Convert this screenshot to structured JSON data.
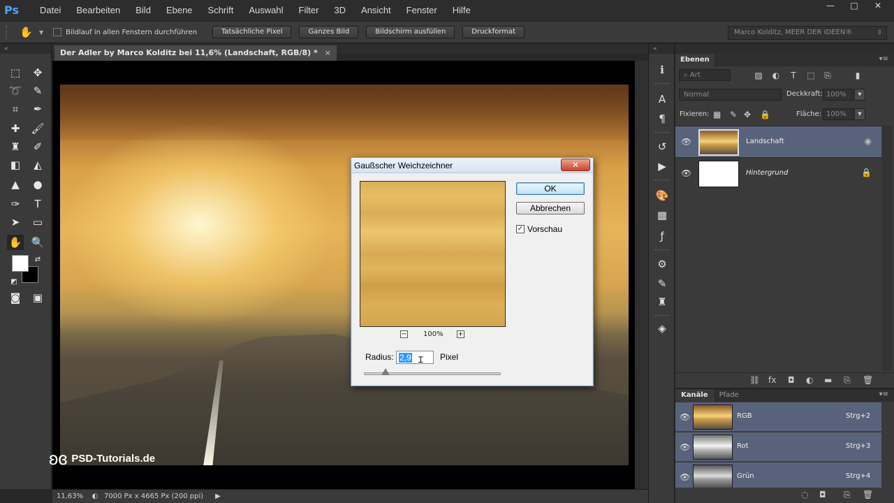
{
  "app": {
    "logo": "Ps",
    "menu": [
      "Datei",
      "Bearbeiten",
      "Bild",
      "Ebene",
      "Schrift",
      "Auswahl",
      "Filter",
      "3D",
      "Ansicht",
      "Fenster",
      "Hilfe"
    ],
    "window_controls": {
      "minimize": "—",
      "maximize": "□",
      "close": "✕"
    }
  },
  "options_bar": {
    "scroll_all_label": "Bildlauf in allen Fenstern durchführen",
    "scroll_all_checked": false,
    "buttons": [
      "Tatsächliche Pixel",
      "Ganzes Bild",
      "Bildschirm ausfüllen",
      "Druckformat"
    ],
    "workspace": "Marco Kolditz, MEER DER IDEEN®"
  },
  "document": {
    "tab_title": "Der Adler by Marco Kolditz bei 11,6% (Landschaft, RGB/8) *",
    "tab_close": "×",
    "watermark": "PSD-Tutorials.de"
  },
  "status_bar": {
    "zoom": "11,63%",
    "doc_info": "7000 Px x 4665 Px (200 ppi)"
  },
  "layers_panel": {
    "tab": "Ebenen",
    "filter_kind": "Art",
    "blend_mode": "Normal",
    "opacity_label": "Deckkraft:",
    "opacity_value": "100%",
    "lock_label": "Fixieren:",
    "fill_label": "Fläche:",
    "fill_value": "100%",
    "layers": [
      {
        "name": "Landschaft",
        "selected": true,
        "visible": true
      },
      {
        "name": "Hintergrund",
        "selected": false,
        "visible": true,
        "locked": true
      }
    ]
  },
  "channels_panel": {
    "tabs": [
      "Kanäle",
      "Pfade"
    ],
    "channels": [
      {
        "name": "RGB",
        "shortcut": "Strg+2"
      },
      {
        "name": "Rot",
        "shortcut": "Strg+3"
      },
      {
        "name": "Grün",
        "shortcut": "Strg+4"
      }
    ]
  },
  "dialog": {
    "title": "Gaußscher Weichzeichner",
    "ok_label": "OK",
    "cancel_label": "Abbrechen",
    "preview_label": "Vorschau",
    "preview_checked": true,
    "zoom_value": "100%",
    "radius_label": "Radius:",
    "radius_value": "2,9",
    "radius_unit": "Pixel",
    "radius_slider_fraction": 0.16
  },
  "colors": {
    "accent_selected": "#58627a",
    "foreground": "#ffffff",
    "background": "#000000"
  }
}
